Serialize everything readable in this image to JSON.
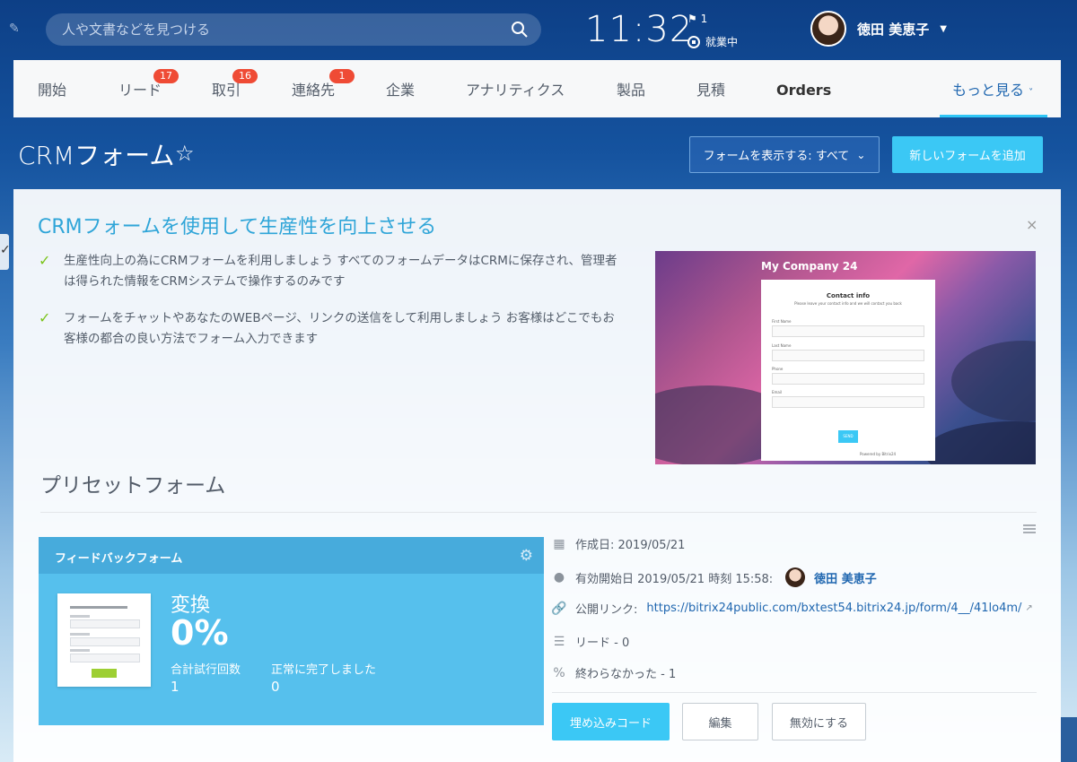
{
  "header": {
    "search_placeholder": "人や文書などを見つける",
    "clock": "11:32",
    "flag_count": "1",
    "work_status": "就業中",
    "user_name": "徳田 美恵子"
  },
  "nav": {
    "items": [
      {
        "label": "開始"
      },
      {
        "label": "リード",
        "badge": "17"
      },
      {
        "label": "取引",
        "badge": "16"
      },
      {
        "label": "連絡先",
        "badge": "1"
      },
      {
        "label": "企業"
      },
      {
        "label": "アナリティクス"
      },
      {
        "label": "製品"
      },
      {
        "label": "見積"
      },
      {
        "label": "Orders"
      },
      {
        "label": "もっと見る"
      }
    ]
  },
  "page": {
    "title": "CRMフォーム",
    "filter_label": "フォームを表示する: すべて",
    "add_label": "新しいフォームを追加"
  },
  "promo": {
    "title": "CRMフォームを使用して生産性を向上させる",
    "bullets": [
      "生産性向上の為にCRMフォームを利用しましょう すべてのフォームデータはCRMに保存され、管理者は得られた情報をCRMシステムで操作するのみです",
      "フォームをチャットやあなたのWEBページ、リンクの送信をして利用しましょう お客様はどこでもお客様の都合の良い方法でフォーム入力できます"
    ],
    "preview": {
      "company": "My Company 24",
      "card_title": "Contact info",
      "card_subtitle": "Please leave your contact info and we will contact you back",
      "fields": [
        "First Name",
        "Last Name",
        "Phone",
        "Email"
      ],
      "submit": "SEND",
      "footer": "Powered by Bitrix24"
    }
  },
  "preset": {
    "section_title": "プリセットフォーム",
    "form_name": "フィードバックフォーム",
    "conversion_label": "変換",
    "conversion_value": "0%",
    "total_label": "合計試行回数",
    "total_value": "1",
    "success_label": "正常に完了しました",
    "success_value": "0",
    "created": "作成日: 2019/05/21",
    "active_since": "有効開始日 2019/05/21 時刻 15:58:",
    "author": "徳田 美恵子",
    "public_link_label": "公開リンク:",
    "public_link": "https://bitrix24public.com/bxtest54.bitrix24.jp/form/4__/41lo4m/",
    "leads": "リード - 0",
    "unfinished": "終わらなかった - 1",
    "embed_label": "埋め込みコード",
    "edit_label": "編集",
    "disable_label": "無効にする"
  }
}
